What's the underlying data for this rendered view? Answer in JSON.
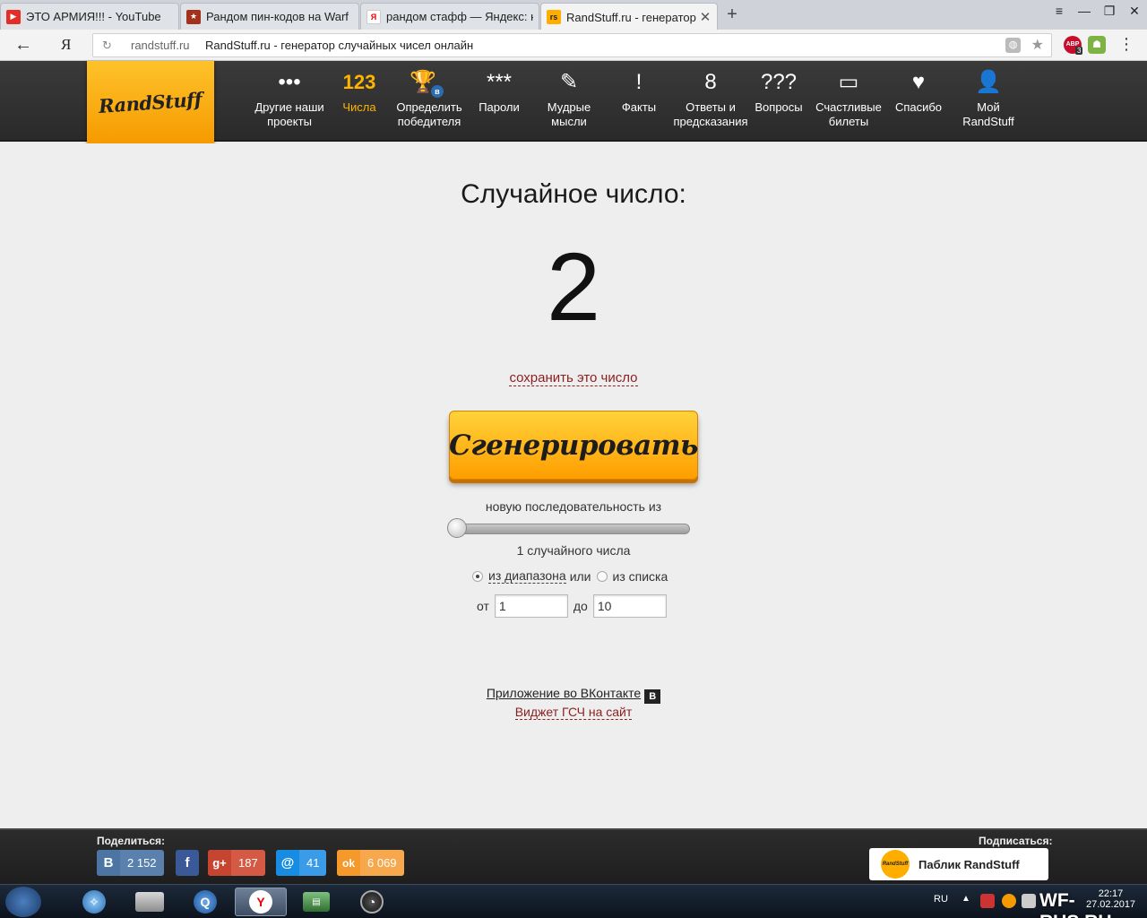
{
  "browser": {
    "tabs": [
      {
        "title": "ЭТО АРМИЯ!!! - YouTube",
        "icon": "youtube-icon"
      },
      {
        "title": "Рандом пин-кодов на Warf",
        "icon": "star-icon"
      },
      {
        "title": "рандом стафф — Яндекс: н",
        "icon": "yandex-icon"
      },
      {
        "title": "RandStuff.ru - генератор",
        "icon": "randstuff-icon"
      }
    ],
    "new_tab": "+",
    "window_buttons": [
      "≡",
      "—",
      "❐",
      "✕"
    ],
    "address_domain": "randstuff.ru",
    "address_title": "RandStuff.ru - генератор случайных чисел онлайн",
    "back": "←",
    "yandex_logo": "Я",
    "abp_label": "ABP",
    "abp_badge": "3"
  },
  "site": {
    "logo": "RandStuff",
    "nav": [
      {
        "icon": "•••",
        "label": "Другие наши проекты",
        "name": "other-projects"
      },
      {
        "icon": "123",
        "label": "Числа",
        "name": "numbers",
        "active": true
      },
      {
        "icon": "🏆",
        "label": "Определить победителя",
        "name": "winner"
      },
      {
        "icon": "***",
        "label": "Пароли",
        "name": "passwords"
      },
      {
        "icon": "✎",
        "label": "Мудрые мысли",
        "name": "wise-thoughts"
      },
      {
        "icon": "!",
        "label": "Факты",
        "name": "facts"
      },
      {
        "icon": "8",
        "label": "Ответы и предсказания",
        "name": "answers"
      },
      {
        "icon": "???",
        "label": "Вопросы",
        "name": "questions"
      },
      {
        "icon": "▭",
        "label": "Счастливые билеты",
        "name": "tickets"
      },
      {
        "icon": "♥",
        "label": "Спасибо",
        "name": "thanks"
      },
      {
        "icon": "👤",
        "label": "Мой RandStuff",
        "name": "my-randstuff"
      }
    ],
    "vk_badge": "в"
  },
  "main": {
    "headline": "Случайное число:",
    "result": "2",
    "save_link": "сохранить это число",
    "generate_button": "Сгенерировать",
    "sequence_text": "новую последовательность из",
    "slider_value": 1,
    "count_text": "1 случайного числа",
    "mode_range_label": "из диапазона",
    "mode_or": "или",
    "mode_list_label": "из списка",
    "from_label": "от",
    "from_value": "1",
    "to_label": "до",
    "to_value": "10",
    "vk_app_link": "Приложение во ВКонтакте",
    "vk_mark": "В",
    "widget_link": "Виджет ГСЧ на сайт"
  },
  "footer": {
    "share_label": "Поделиться:",
    "subscribe_label": "Подписаться:",
    "shares": [
      {
        "network": "vk",
        "icon": "B",
        "count": "2 152",
        "color": "#4c75a3"
      },
      {
        "network": "facebook",
        "icon": "f",
        "count": "",
        "color": "#3b5998"
      },
      {
        "network": "google-plus",
        "icon": "g+",
        "count": "187",
        "color": "#c64531"
      },
      {
        "network": "mailru",
        "icon": "@",
        "count": "41",
        "color": "#168de2"
      },
      {
        "network": "odnoklassniki",
        "icon": "ok",
        "count": "6 069",
        "color": "#f59a2a"
      }
    ],
    "public_button": "Паблик RandStuff",
    "public_logo": "RandStuff"
  },
  "taskbar": {
    "lang": "RU",
    "tray_arrow": "▲",
    "clock_time": "22:17",
    "clock_date": "27.02.2017",
    "watermark": "WF-RUS.RU"
  },
  "colors": {
    "accent": "#ffb400",
    "link_red": "#8a1f1f",
    "header_bg": "#2e2e2e"
  }
}
